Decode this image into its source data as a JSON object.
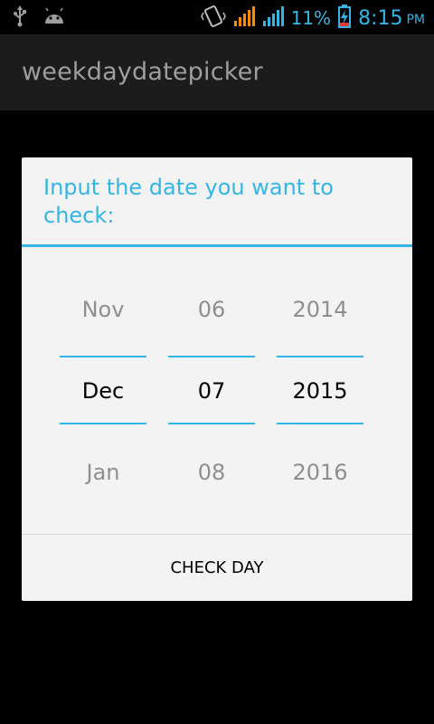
{
  "status_bar": {
    "icons": [
      "usb-icon",
      "android-icon",
      "vibrate-icon",
      "signal-icon-1",
      "signal-icon-2",
      "battery-charging-icon"
    ],
    "battery_pct": "11%",
    "time": "8:15",
    "ampm": "PM",
    "accent": "#33b5e5"
  },
  "action_bar": {
    "title": "weekdaydatepicker"
  },
  "dialog": {
    "title": "Input the date you want to check:",
    "month": {
      "prev": "Nov",
      "current": "Dec",
      "next": "Jan"
    },
    "day": {
      "prev": "06",
      "current": "07",
      "next": "08"
    },
    "year": {
      "prev": "2014",
      "current": "2015",
      "next": "2016"
    },
    "button_label": "CHECK DAY"
  }
}
